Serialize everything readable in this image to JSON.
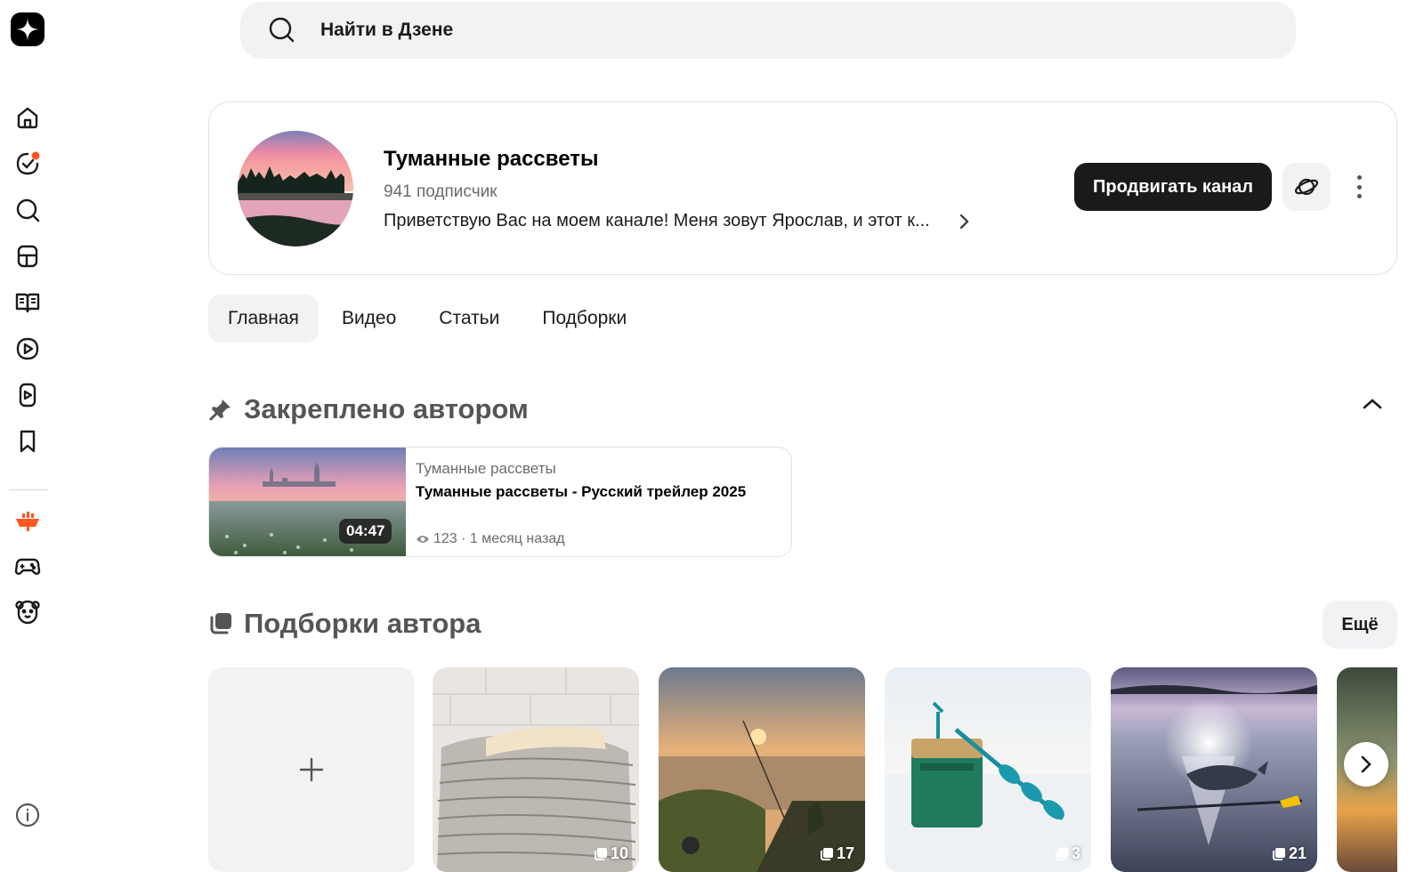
{
  "search": {
    "placeholder": "Найти в Дзене"
  },
  "sidebar": {
    "items": [
      {
        "icon": "home-icon"
      },
      {
        "icon": "subscriptions-icon",
        "badge_color": "#ff5722"
      },
      {
        "icon": "search-icon"
      },
      {
        "icon": "news-icon"
      },
      {
        "icon": "articles-icon"
      },
      {
        "icon": "video-icon"
      },
      {
        "icon": "shorts-icon"
      },
      {
        "icon": "bookmark-icon"
      },
      {
        "icon": "studio-ship-icon"
      },
      {
        "icon": "games-icon"
      },
      {
        "icon": "kids-bear-icon"
      },
      {
        "icon": "info-icon"
      }
    ]
  },
  "channel": {
    "title": "Туманные рассветы",
    "subscribers": "941 подписчик",
    "description": "Приветствую Вас на моем канале! Меня зовут Ярослав, и этот к...",
    "promote_label": "Продвигать канал"
  },
  "tabs": [
    {
      "label": "Главная",
      "active": true
    },
    {
      "label": "Видео",
      "active": false
    },
    {
      "label": "Статьи",
      "active": false
    },
    {
      "label": "Подборки",
      "active": false
    }
  ],
  "pinned": {
    "section_title": "Закреплено автором",
    "channel": "Туманные рассветы",
    "title": "Туманные рассветы - Русский трейлер 2025",
    "duration": "04:47",
    "meta": "123 · 1 месяц назад"
  },
  "collections": {
    "section_title": "Подборки автора",
    "more_label": "Ещё",
    "items": [
      {
        "count": "10"
      },
      {
        "count": "17"
      },
      {
        "count": "3"
      },
      {
        "count": "21"
      }
    ]
  },
  "colors": {
    "accent": "#ff5722",
    "dark_button": "#1a1a1a",
    "surface": "#f1f2f4"
  }
}
